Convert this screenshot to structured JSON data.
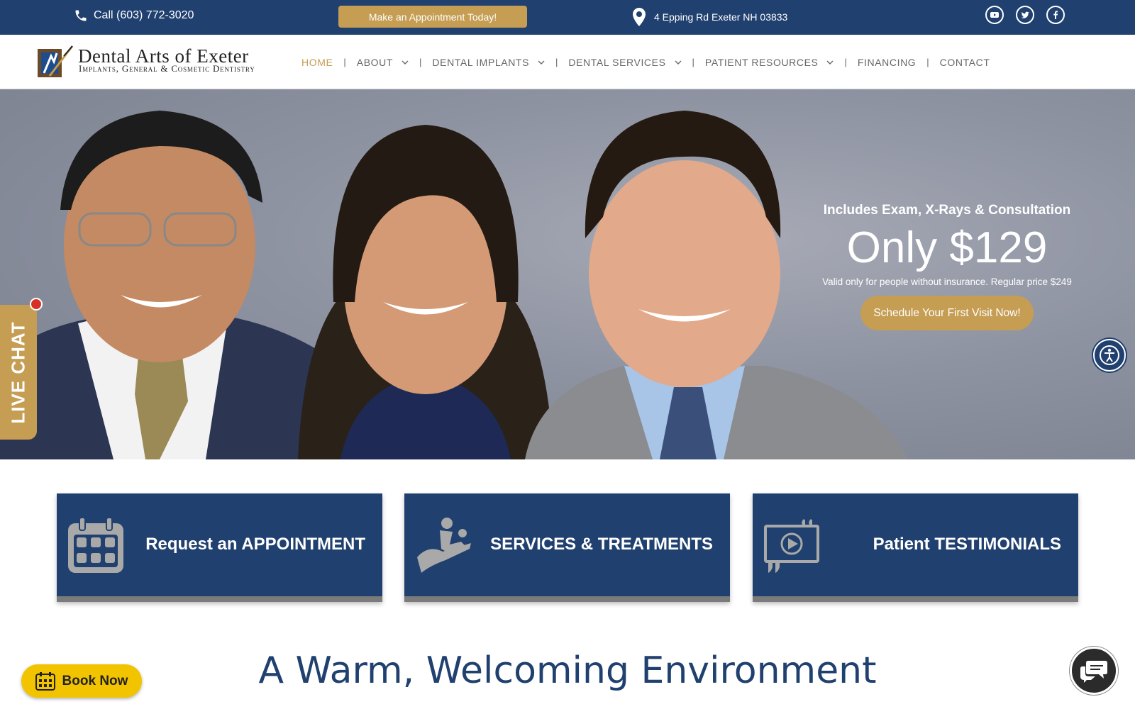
{
  "topbar": {
    "phone": "Call (603) 772-3020",
    "cta": "Make an Appointment Today!",
    "address": "4 Epping Rd Exeter NH 03833",
    "social": [
      "youtube-icon",
      "twitter-icon",
      "facebook-icon"
    ]
  },
  "logo": {
    "title": "Dental Arts of Exeter",
    "subtitle": "Implants, General & Cosmetic Dentistry"
  },
  "nav": {
    "items": [
      {
        "label": "HOME",
        "active": true
      },
      {
        "label": "ABOUT",
        "dropdown": true
      },
      {
        "label": "DENTAL IMPLANTS",
        "dropdown": true
      },
      {
        "label": "DENTAL SERVICES",
        "dropdown": true
      },
      {
        "label": "PATIENT RESOURCES",
        "dropdown": true
      },
      {
        "label": "FINANCING"
      },
      {
        "label": "CONTACT"
      }
    ],
    "separator": "|"
  },
  "hero": {
    "includes": "Includes Exam, X-Rays & Consultation",
    "price": "Only $129",
    "note": "Valid only for people without insurance. Regular price $249",
    "button": "Schedule Your First Visit Now!"
  },
  "livechat": "LIVE CHAT",
  "boxes": [
    {
      "label": "Request an APPOINTMENT",
      "icon": "calendar-icon"
    },
    {
      "label": "SERVICES & TREATMENTS",
      "icon": "dental-chair-icon"
    },
    {
      "label": "Patient TESTIMONIALS",
      "icon": "video-testimonial-icon"
    }
  ],
  "welcome": "A Warm, Welcoming Environment",
  "book_now": "Book Now",
  "colors": {
    "navy": "#20406f",
    "gold": "#c59d53",
    "yellow": "#f2c400"
  }
}
